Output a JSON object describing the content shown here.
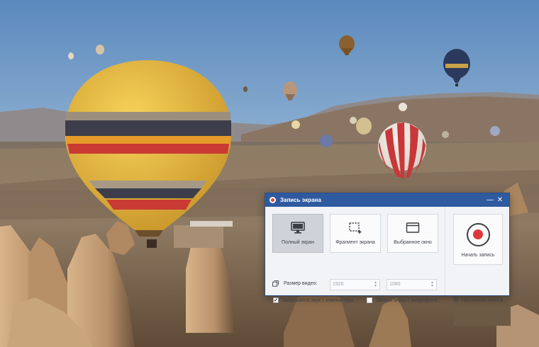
{
  "window": {
    "title": "Запись экрана",
    "close_glyph": "✕",
    "minimize_glyph": "—"
  },
  "modes": [
    {
      "label": "Полный экран",
      "icon": "monitor-icon",
      "active": true
    },
    {
      "label": "Фрагмент экрана",
      "icon": "region-select-icon",
      "active": false
    },
    {
      "label": "Выбранное окно",
      "icon": "window-icon",
      "active": false
    }
  ],
  "video_size": {
    "label": "Размер видео:",
    "width": "1920",
    "height": "1080"
  },
  "audio": {
    "system_label": "Записывать звук с компьютера",
    "system_checked": true,
    "mic_label": "Запись звука с микрофона",
    "mic_checked": false
  },
  "record": {
    "label": "Начать запись"
  },
  "settings": {
    "label": "Настройки записи"
  },
  "colors": {
    "titlebar": "#2f5aa0",
    "record_dot": "#dc3a3a",
    "window_bg": "#f1f3f6"
  }
}
